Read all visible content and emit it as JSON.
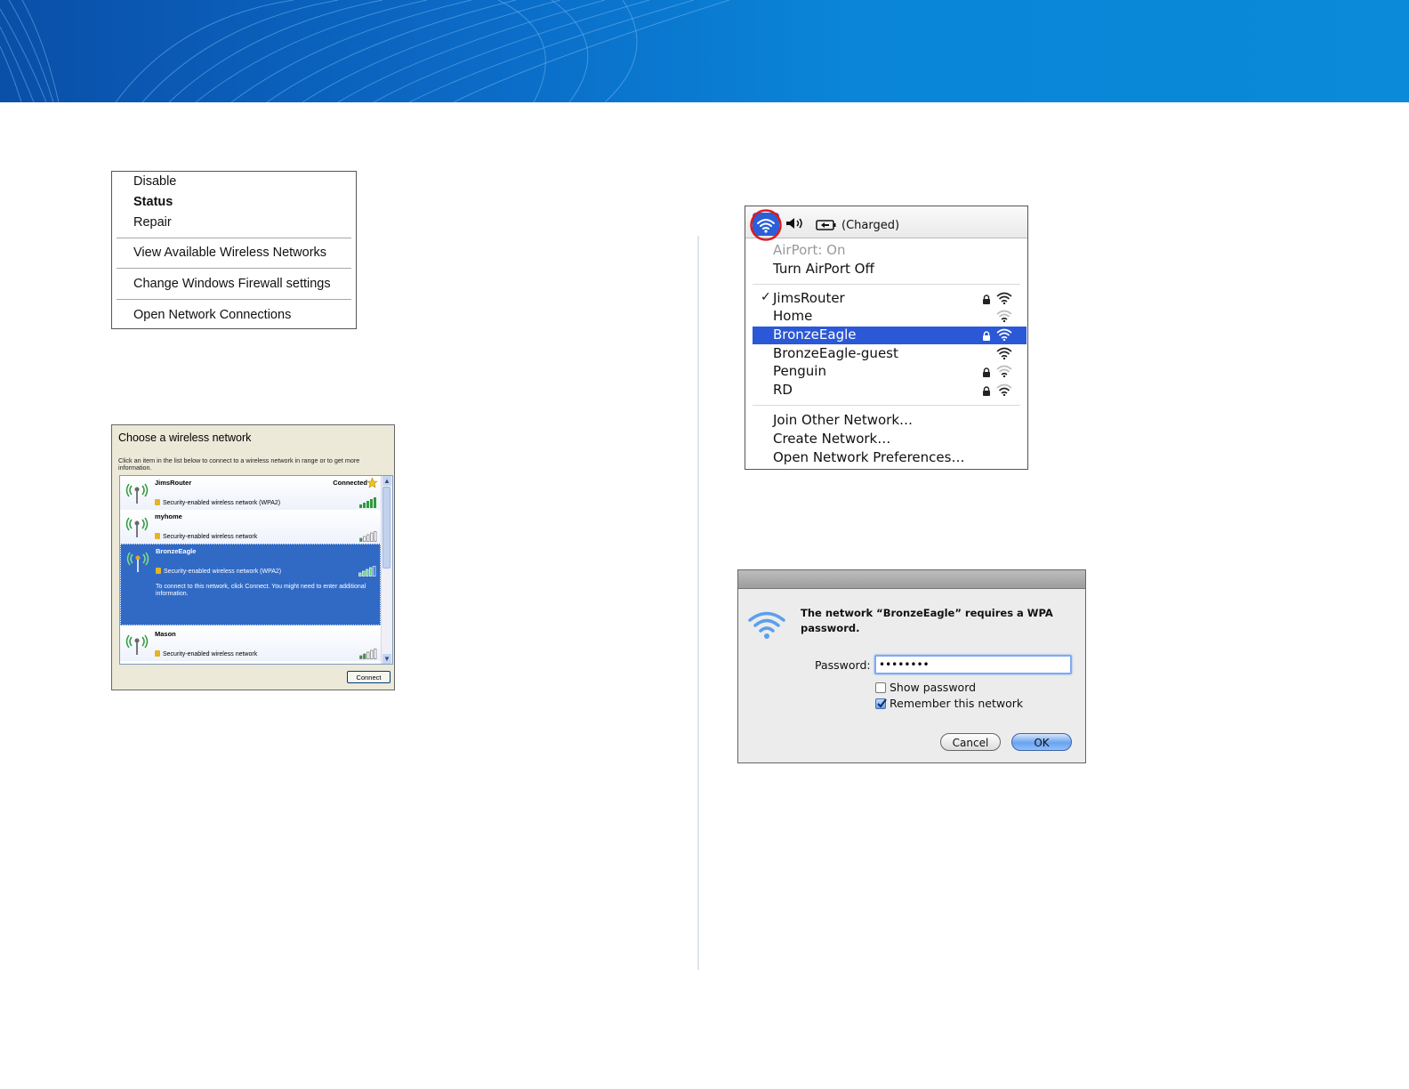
{
  "context_menu": {
    "items": [
      "Disable",
      "Status",
      "Repair",
      "View Available Wireless Networks",
      "Change Windows Firewall settings",
      "Open Network Connections"
    ]
  },
  "xp_dialog": {
    "title": "Choose a wireless network",
    "instructions": "Click an item in the list below to connect to a wireless network in range or to get more information.",
    "networks": [
      {
        "name": "JimsRouter",
        "status": "Connected",
        "security": "Security-enabled wireless network (WPA2)"
      },
      {
        "name": "myhome",
        "status": "",
        "security": "Security-enabled wireless network"
      },
      {
        "name": "BronzeEagle",
        "status": "",
        "security": "Security-enabled wireless network (WPA2)",
        "message": "To connect to this network, click Connect. You might need to enter additional information."
      },
      {
        "name": "Mason",
        "status": "",
        "security": "Security-enabled wireless network"
      }
    ],
    "connect_button": "Connect",
    "colors": {
      "selection": "#316ac5",
      "window": "#ece9d8"
    }
  },
  "mac_menu": {
    "battery_label": "(Charged)",
    "airport_status": "AirPort: On",
    "toggle_label": "Turn AirPort Off",
    "networks": [
      {
        "name": "JimsRouter",
        "checked": true,
        "locked": true
      },
      {
        "name": "Home",
        "checked": false,
        "locked": false
      },
      {
        "name": "BronzeEagle",
        "checked": false,
        "locked": true
      },
      {
        "name": "BronzeEagle-guest",
        "checked": false,
        "locked": false
      },
      {
        "name": "Penguin",
        "checked": false,
        "locked": true
      },
      {
        "name": "RD",
        "checked": false,
        "locked": true
      }
    ],
    "check_mark": "✓",
    "actions": [
      "Join Other Network…",
      "Create Network…",
      "Open Network Preferences…"
    ],
    "colors": {
      "highlight": "#2a58d6",
      "callout_circle": "#e0191d"
    }
  },
  "mac_dialog": {
    "message": "The network “BronzeEagle” requires a WPA password.",
    "password_label": "Password:",
    "password_value": "••••••••",
    "show_password_label": "Show password",
    "show_password_checked": false,
    "remember_label": "Remember this network",
    "remember_checked": true,
    "cancel_label": "Cancel",
    "ok_label": "OK"
  }
}
